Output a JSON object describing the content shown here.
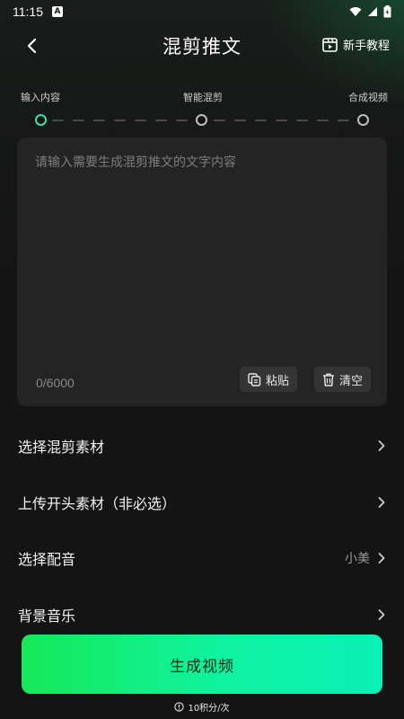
{
  "status_bar": {
    "time": "11:15",
    "notification_glyph": "A"
  },
  "header": {
    "title": "混剪推文",
    "tutorial_label": "新手教程"
  },
  "steps": [
    {
      "label": "输入内容",
      "active": true
    },
    {
      "label": "智能混剪",
      "active": false
    },
    {
      "label": "合成视频",
      "active": false
    }
  ],
  "input_card": {
    "placeholder": "请输入需要生成混剪推文的文字内容",
    "char_count": "0/6000",
    "paste_label": "粘贴",
    "clear_label": "清空"
  },
  "options": [
    {
      "label": "选择混剪素材",
      "value": ""
    },
    {
      "label": "上传开头素材（非必选）",
      "value": ""
    },
    {
      "label": "选择配音",
      "value": "小美"
    },
    {
      "label": "背景音乐",
      "value": ""
    }
  ],
  "footer": {
    "generate_label": "生成视频",
    "cost_note": "10积分/次"
  },
  "colors": {
    "accent_start": "#16e858",
    "accent_end": "#0af0b6",
    "active_step": "#3fe0a0",
    "background": "#141414",
    "card": "#242424"
  }
}
